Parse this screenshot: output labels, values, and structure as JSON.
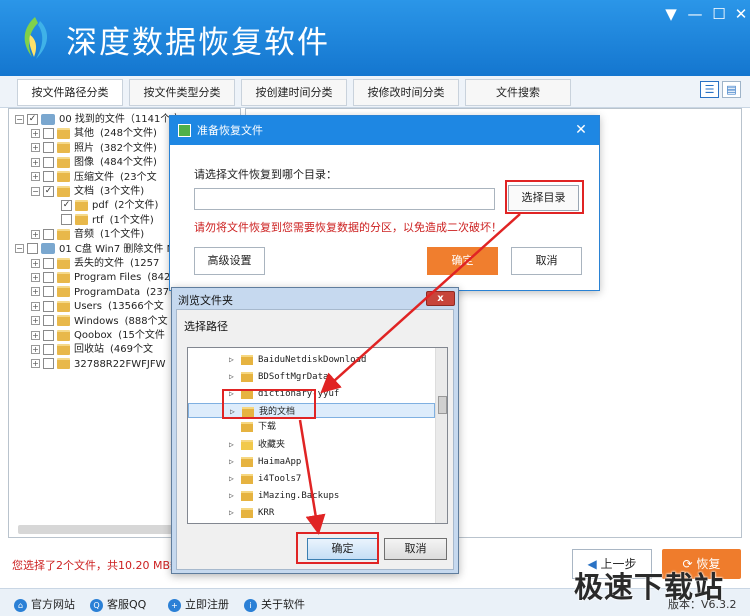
{
  "app": {
    "title": "深度数据恢复软件",
    "window_controls": [
      "▼",
      "—",
      "☐",
      "✕"
    ]
  },
  "tabs": [
    {
      "label": "按文件路径分类"
    },
    {
      "label": "按文件类型分类"
    },
    {
      "label": "按创建时间分类"
    },
    {
      "label": "按修改时间分类"
    },
    {
      "label": "文件搜索"
    }
  ],
  "view_icons": [
    "list-view-icon",
    "detail-view-icon"
  ],
  "tree": [
    {
      "exp": "−",
      "check": "✓",
      "icon": "drive",
      "label": "00 找到的文件（1141个文",
      "count": ""
    },
    {
      "exp": "+",
      "check": "",
      "icon": "folder",
      "label": "其他",
      "count": "(248个文件)"
    },
    {
      "exp": "+",
      "check": "",
      "icon": "folder",
      "label": "照片",
      "count": "(382个文件)"
    },
    {
      "exp": "+",
      "check": "",
      "icon": "folder",
      "label": "图像",
      "count": "(484个文件)"
    },
    {
      "exp": "+",
      "check": "",
      "icon": "folder",
      "label": "压缩文件",
      "count": "(23个文"
    },
    {
      "exp": "−",
      "check": "✓",
      "icon": "folder",
      "label": "文档",
      "count": "(3个文件)"
    },
    {
      "exp": "",
      "check": "✓",
      "icon": "folder",
      "label": "pdf",
      "count": "(2个文件)"
    },
    {
      "exp": "",
      "check": "",
      "icon": "folder",
      "label": "rtf",
      "count": "(1个文件)"
    },
    {
      "exp": "+",
      "check": "",
      "icon": "folder",
      "label": "音频",
      "count": "(1个文件)"
    },
    {
      "exp": "−",
      "check": "",
      "icon": "drive",
      "label": "01 C盘 Win7 删除文件 N",
      "count": ""
    },
    {
      "exp": "+",
      "check": "",
      "icon": "folder",
      "label": "丢失的文件",
      "count": "(1257"
    },
    {
      "exp": "+",
      "check": "",
      "icon": "folder",
      "label": "Program Files",
      "count": "(842"
    },
    {
      "exp": "+",
      "check": "",
      "icon": "folder",
      "label": "ProgramData",
      "count": "(237"
    },
    {
      "exp": "+",
      "check": "",
      "icon": "folder",
      "label": "Users",
      "count": "(13566个文"
    },
    {
      "exp": "+",
      "check": "",
      "icon": "folder",
      "label": "Windows",
      "count": "(888个文"
    },
    {
      "exp": "+",
      "check": "",
      "icon": "folder",
      "label": "Qoobox",
      "count": "(15个文件"
    },
    {
      "exp": "+",
      "check": "",
      "icon": "folder",
      "label": "回收站",
      "count": "(469个文"
    },
    {
      "exp": "+",
      "check": "",
      "icon": "folder",
      "label": "32788R22FWFJFW",
      "count": ""
    }
  ],
  "status": "您选择了2个文件，共10.20 MB数据",
  "buttons": {
    "prev": "上一步",
    "recover": "恢复"
  },
  "bottom_links": [
    {
      "label": "官方网站",
      "icon": "home-icon"
    },
    {
      "label": "客服QQ",
      "icon": "qq-icon"
    },
    {
      "label": "立即注册",
      "icon": "register-icon"
    },
    {
      "label": "关于软件",
      "icon": "info-icon"
    }
  ],
  "version": "版本：V6.3.2",
  "watermark": "极速下载站",
  "dialog_recover": {
    "title": "准备恢复文件",
    "close": "✕",
    "prompt": "请选择文件恢复到哪个目录：",
    "path_value": "",
    "choose_dir": "选择目录",
    "warning": "请勿将文件恢复到您需要恢复数据的分区，以免造成二次破坏！",
    "advanced": "高级设置",
    "ok": "确定",
    "cancel": "取消"
  },
  "dialog_browse": {
    "title": "浏览文件夹",
    "close": "x",
    "label": "选择路径",
    "folders": [
      {
        "name": "BaiduNetdiskDownload",
        "arrow": "▷",
        "selected": false
      },
      {
        "name": "BDSoftMgrData",
        "arrow": "▷",
        "selected": false
      },
      {
        "name": "dictionary-yyuf",
        "arrow": "▷",
        "selected": false
      },
      {
        "name": "我的文档",
        "arrow": "▷",
        "selected": true
      },
      {
        "name": "下载",
        "arrow": "",
        "selected": false
      },
      {
        "name": "收藏夹",
        "arrow": "▷",
        "selected": false
      },
      {
        "name": "HaimaApp",
        "arrow": "▷",
        "selected": false
      },
      {
        "name": "i4Tools7",
        "arrow": "▷",
        "selected": false
      },
      {
        "name": "iMazing.Backups",
        "arrow": "▷",
        "selected": false
      },
      {
        "name": "KRR",
        "arrow": "▷",
        "selected": false
      }
    ],
    "ok": "确定",
    "cancel": "取消"
  },
  "accent_colors": {
    "title_blue": "#1e87e3",
    "orange": "#f07e2e",
    "annotation_red": "#e02424"
  }
}
